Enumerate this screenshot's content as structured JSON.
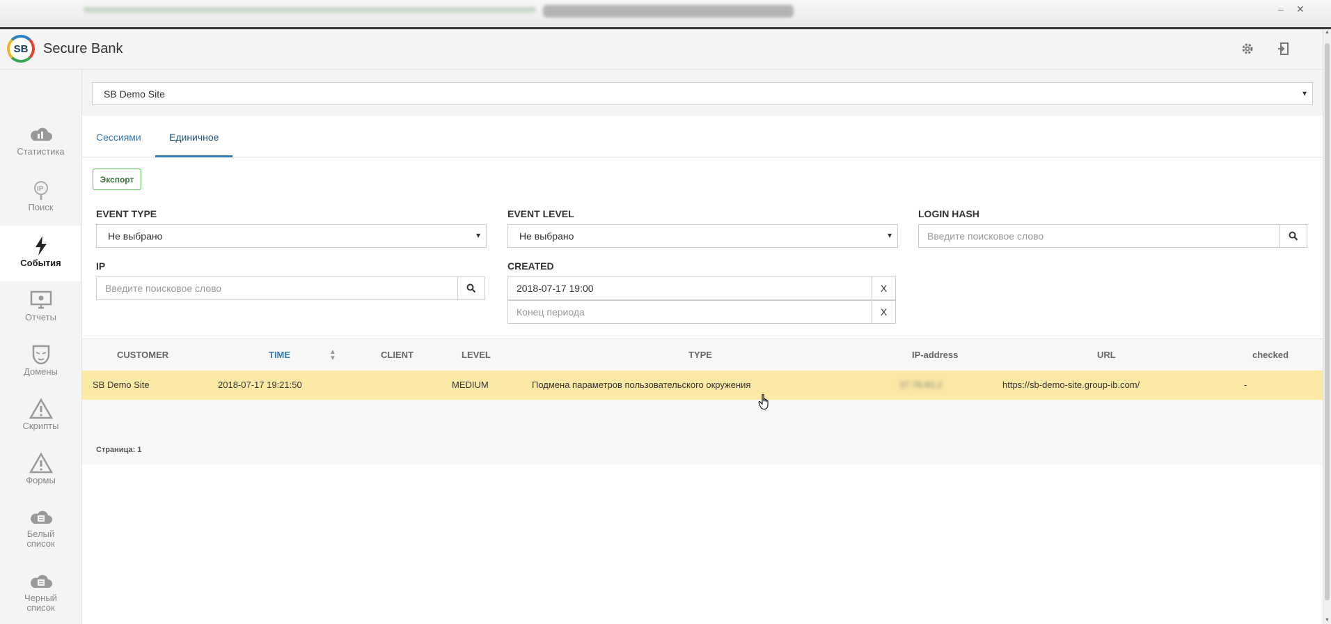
{
  "app": {
    "title": "Secure Bank",
    "logo_text": "SB"
  },
  "site_select": {
    "value": "SB Demo Site"
  },
  "sidebar": {
    "items": [
      {
        "label": "Статистика",
        "icon": "cloud-chart-icon"
      },
      {
        "label": "Поиск",
        "icon": "ip-search-icon"
      },
      {
        "label": "События",
        "icon": "lightning-icon",
        "active": true
      },
      {
        "label": "Отчеты",
        "icon": "monitor-bug-icon"
      },
      {
        "label": "Домены",
        "icon": "mask-icon"
      },
      {
        "label": "Скрипты",
        "icon": "warning-icon"
      },
      {
        "label": "Формы",
        "icon": "warning-icon"
      },
      {
        "label": "Белый список",
        "icon": "cloud-list-icon"
      },
      {
        "label": "Черный список",
        "icon": "cloud-list-icon"
      }
    ]
  },
  "tabs": [
    {
      "label": "Сессиями",
      "active": false
    },
    {
      "label": "Единичное",
      "active": true
    }
  ],
  "export_label": "Экспорт",
  "filters": {
    "event_type": {
      "label": "EVENT TYPE",
      "value": "Не выбрано"
    },
    "event_level": {
      "label": "EVENT LEVEL",
      "value": "Не выбрано"
    },
    "login_hash": {
      "label": "LOGIN HASH",
      "placeholder": "Введите поисковое слово"
    },
    "ip": {
      "label": "IP",
      "placeholder": "Введите поисковое слово"
    },
    "created": {
      "label": "CREATED",
      "start_value": "2018-07-17 19:00",
      "end_placeholder": "Конец периода",
      "clear_label": "X"
    }
  },
  "table": {
    "headers": [
      "CUSTOMER",
      "TIME",
      "CLIENT",
      "LEVEL",
      "TYPE",
      "IP-address",
      "URL",
      "checked"
    ],
    "rows": [
      {
        "customer": "SB Demo Site",
        "time": "2018-07-17 19:21:50",
        "client": "",
        "level": "MEDIUM",
        "type": "Подмена параметров пользовательского окружения",
        "ip": "37.78.83.2",
        "url": "https://sb-demo-site.group-ib.com/",
        "checked": "-"
      }
    ]
  },
  "pager": "Страница: 1",
  "colors": {
    "accent": "#337ab7",
    "row_highlight": "#fde9a6",
    "export_green": "#5cb85c"
  }
}
